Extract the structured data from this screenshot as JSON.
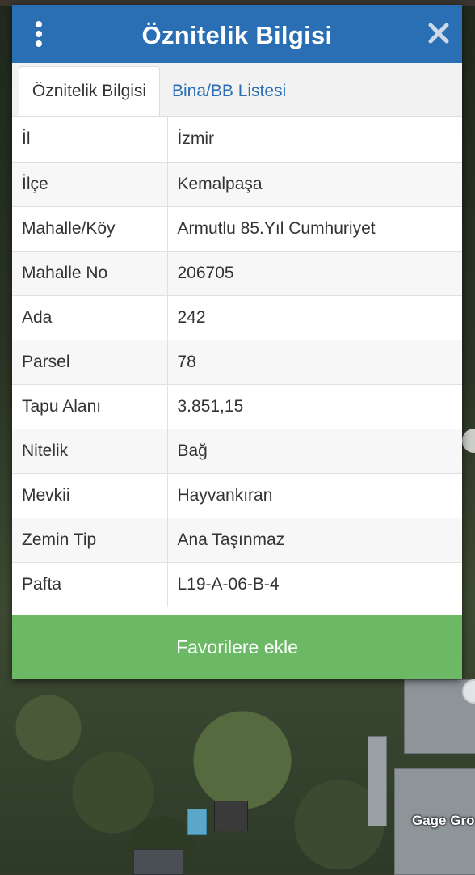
{
  "dialog": {
    "title": "Öznitelik Bilgisi",
    "menu_icon": "kebab-menu-icon",
    "close_icon": "close-icon",
    "accent_color": "#2a6fb4",
    "tabs": [
      {
        "label": "Öznitelik Bilgisi",
        "active": true
      },
      {
        "label": "Bina/BB Listesi",
        "active": false
      }
    ],
    "rows": [
      {
        "key": "İl",
        "value": "İzmir"
      },
      {
        "key": "İlçe",
        "value": "Kemalpaşa"
      },
      {
        "key": "Mahalle/Köy",
        "value": "Armutlu 85.Yıl Cumhuriyet"
      },
      {
        "key": "Mahalle No",
        "value": "206705"
      },
      {
        "key": "Ada",
        "value": "242"
      },
      {
        "key": "Parsel",
        "value": "78"
      },
      {
        "key": "Tapu Alanı",
        "value": "3.851,15"
      },
      {
        "key": "Nitelik",
        "value": "Bağ"
      },
      {
        "key": "Mevkii",
        "value": "Hayvankıran"
      },
      {
        "key": "Zemin Tip",
        "value": "Ana Taşınmaz"
      },
      {
        "key": "Pafta",
        "value": "L19-A-06-B-4"
      }
    ],
    "favorite_button": {
      "label": "Favorilere ekle",
      "color": "#6bb965"
    }
  },
  "map": {
    "place_label": "Gage Gro"
  }
}
